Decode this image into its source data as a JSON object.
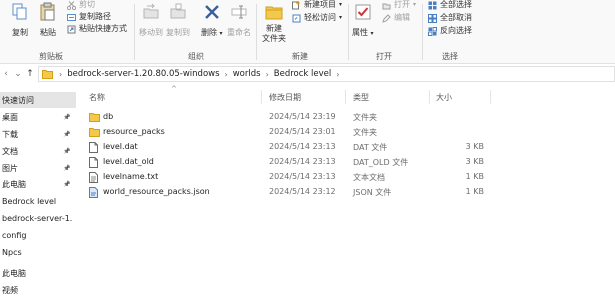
{
  "ribbon": {
    "copy": "复制",
    "paste": "粘贴",
    "cut": "剪切",
    "copy_path": "复制路径",
    "paste_shortcut": "粘贴快捷方式",
    "move_to": "移动到",
    "copy_to": "复制到",
    "delete": "删除",
    "rename": "重命名",
    "new_folder_line1": "新建",
    "new_folder_line2": "文件夹",
    "new_item": "新建项目",
    "easy_access": "轻松访问",
    "properties": "属性",
    "open": "打开",
    "edit": "编辑",
    "select_all": "全部选择",
    "select_none": "全部取消",
    "invert_selection": "反向选择",
    "groups": {
      "clipboard": "剪贴板",
      "organize": "组织",
      "new": "新建",
      "open": "打开",
      "select": "选择"
    }
  },
  "address": {
    "crumbs": [
      "bedrock-server-1.20.80.05-windows",
      "worlds",
      "Bedrock level"
    ]
  },
  "nav": {
    "items": [
      {
        "label": "快速访问",
        "pinned": false
      },
      {
        "label": "桌面",
        "pinned": true
      },
      {
        "label": "下载",
        "pinned": true
      },
      {
        "label": "文档",
        "pinned": true
      },
      {
        "label": "图片",
        "pinned": true
      },
      {
        "label": "此电脑",
        "pinned": true
      },
      {
        "label": "Bedrock level",
        "pinned": false
      },
      {
        "label": "bedrock-server-1.",
        "pinned": false
      },
      {
        "label": "config",
        "pinned": false
      },
      {
        "label": "Npcs",
        "pinned": false
      },
      {
        "label": "此电脑",
        "pinned": false
      },
      {
        "label": "视频",
        "pinned": false
      }
    ]
  },
  "columns": {
    "name": "名称",
    "modified": "修改日期",
    "type": "类型",
    "size": "大小"
  },
  "files": [
    {
      "name": "db",
      "modified": "2024/5/14 23:19",
      "type": "文件夹",
      "size": "",
      "icon": "folder"
    },
    {
      "name": "resource_packs",
      "modified": "2024/5/14 23:01",
      "type": "文件夹",
      "size": "",
      "icon": "folder"
    },
    {
      "name": "level.dat",
      "modified": "2024/5/14 23:13",
      "type": "DAT 文件",
      "size": "3 KB",
      "icon": "file"
    },
    {
      "name": "level.dat_old",
      "modified": "2024/5/14 23:13",
      "type": "DAT_OLD 文件",
      "size": "3 KB",
      "icon": "file"
    },
    {
      "name": "levelname.txt",
      "modified": "2024/5/14 23:13",
      "type": "文本文档",
      "size": "1 KB",
      "icon": "text-file"
    },
    {
      "name": "world_resource_packs.json",
      "modified": "2024/5/14 23:12",
      "type": "JSON 文件",
      "size": "1 KB",
      "icon": "json-file"
    }
  ]
}
